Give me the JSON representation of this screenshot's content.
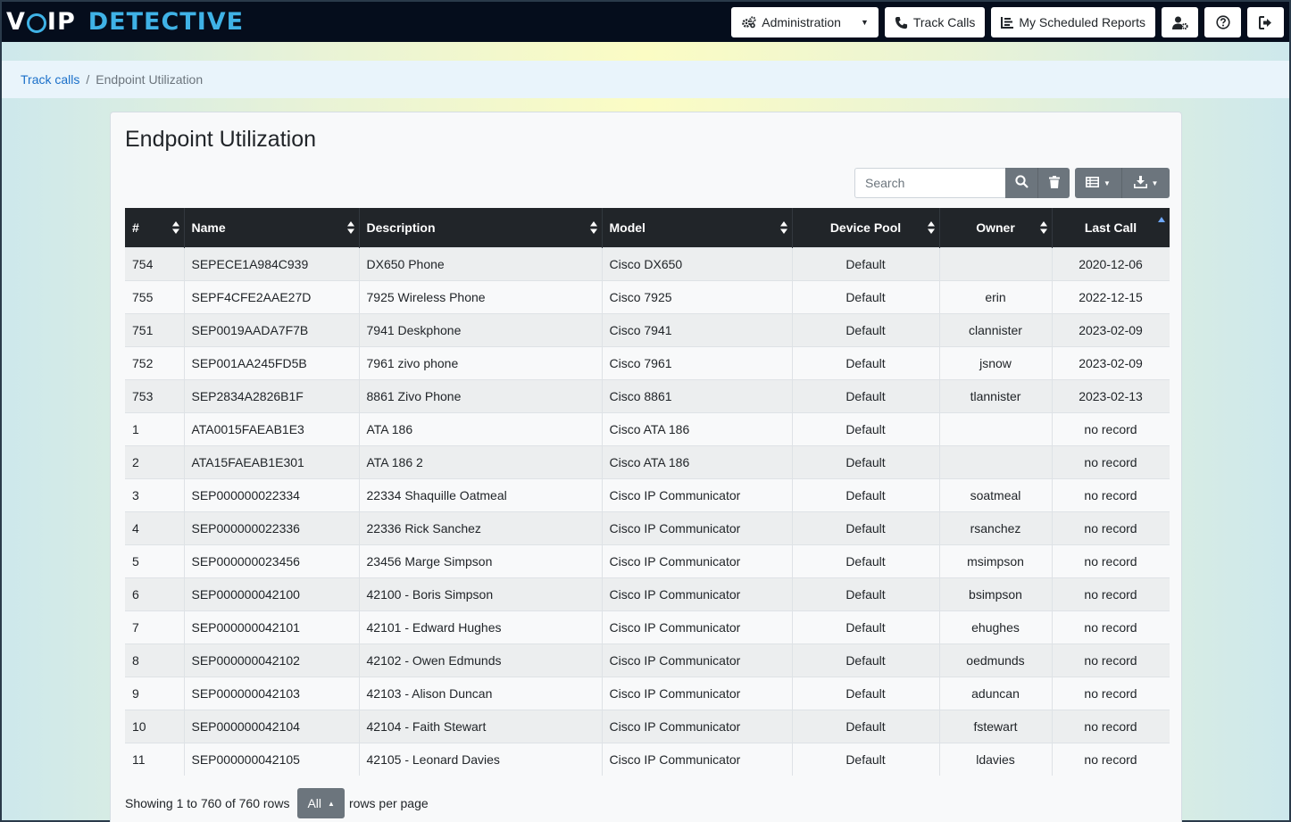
{
  "brand": {
    "part1": "V",
    "part2": "IP",
    "part3": "DETECTIVE"
  },
  "nav": {
    "administration": "Administration",
    "track_calls": "Track Calls",
    "scheduled_reports": "My Scheduled Reports",
    "icons": [
      "user-gear-icon",
      "help-icon",
      "logout-icon"
    ]
  },
  "breadcrumb": {
    "link": "Track calls",
    "separator": "/",
    "current": "Endpoint Utilization"
  },
  "page_title": "Endpoint Utilization",
  "search": {
    "placeholder": "Search",
    "value": ""
  },
  "table": {
    "columns": [
      "#",
      "Name",
      "Description",
      "Model",
      "Device Pool",
      "Owner",
      "Last Call"
    ],
    "rows": [
      [
        "754",
        "SEPECE1A984C939",
        "DX650 Phone",
        "Cisco DX650",
        "Default",
        "",
        "2020-12-06"
      ],
      [
        "755",
        "SEPF4CFE2AAE27D",
        "7925 Wireless Phone",
        "Cisco 7925",
        "Default",
        "erin",
        "2022-12-15"
      ],
      [
        "751",
        "SEP0019AADA7F7B",
        "7941 Deskphone",
        "Cisco 7941",
        "Default",
        "clannister",
        "2023-02-09"
      ],
      [
        "752",
        "SEP001AA245FD5B",
        "7961 zivo phone",
        "Cisco 7961",
        "Default",
        "jsnow",
        "2023-02-09"
      ],
      [
        "753",
        "SEP2834A2826B1F",
        "8861 Zivo Phone",
        "Cisco 8861",
        "Default",
        "tlannister",
        "2023-02-13"
      ],
      [
        "1",
        "ATA0015FAEAB1E3",
        "ATA 186",
        "Cisco ATA 186",
        "Default",
        "",
        "no record"
      ],
      [
        "2",
        "ATA15FAEAB1E301",
        "ATA 186 2",
        "Cisco ATA 186",
        "Default",
        "",
        "no record"
      ],
      [
        "3",
        "SEP000000022334",
        "22334 Shaquille Oatmeal",
        "Cisco IP Communicator",
        "Default",
        "soatmeal",
        "no record"
      ],
      [
        "4",
        "SEP000000022336",
        "22336 Rick Sanchez",
        "Cisco IP Communicator",
        "Default",
        "rsanchez",
        "no record"
      ],
      [
        "5",
        "SEP000000023456",
        "23456 Marge Simpson",
        "Cisco IP Communicator",
        "Default",
        "msimpson",
        "no record"
      ],
      [
        "6",
        "SEP000000042100",
        "42100 - Boris Simpson",
        "Cisco IP Communicator",
        "Default",
        "bsimpson",
        "no record"
      ],
      [
        "7",
        "SEP000000042101",
        "42101 - Edward Hughes",
        "Cisco IP Communicator",
        "Default",
        "ehughes",
        "no record"
      ],
      [
        "8",
        "SEP000000042102",
        "42102 - Owen Edmunds",
        "Cisco IP Communicator",
        "Default",
        "oedmunds",
        "no record"
      ],
      [
        "9",
        "SEP000000042103",
        "42103 - Alison Duncan",
        "Cisco IP Communicator",
        "Default",
        "aduncan",
        "no record"
      ],
      [
        "10",
        "SEP000000042104",
        "42104 - Faith Stewart",
        "Cisco IP Communicator",
        "Default",
        "fstewart",
        "no record"
      ],
      [
        "11",
        "SEP000000042105",
        "42105 - Leonard Davies",
        "Cisco IP Communicator",
        "Default",
        "ldavies",
        "no record"
      ]
    ]
  },
  "footer": {
    "showing": "Showing 1 to 760 of 760 rows",
    "page_size": "All",
    "suffix": "rows per page"
  }
}
